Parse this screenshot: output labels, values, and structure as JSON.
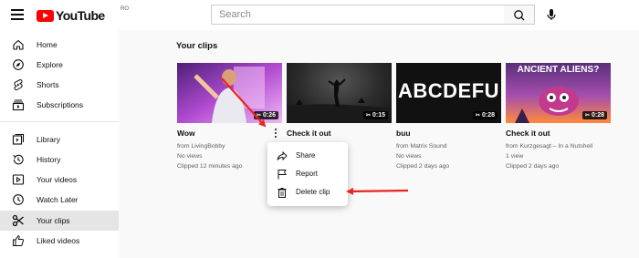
{
  "header": {
    "logo_text": "YouTube",
    "country_code": "RO",
    "search_placeholder": "Search"
  },
  "sidebar": {
    "items": [
      {
        "label": "Home",
        "icon": "home-icon"
      },
      {
        "label": "Explore",
        "icon": "compass-icon"
      },
      {
        "label": "Shorts",
        "icon": "shorts-icon"
      },
      {
        "label": "Subscriptions",
        "icon": "subscriptions-icon"
      },
      {
        "label": "Library",
        "icon": "library-icon"
      },
      {
        "label": "History",
        "icon": "history-icon"
      },
      {
        "label": "Your videos",
        "icon": "play-square-icon"
      },
      {
        "label": "Watch Later",
        "icon": "clock-icon"
      },
      {
        "label": "Your clips",
        "icon": "scissors-icon"
      },
      {
        "label": "Liked videos",
        "icon": "thumbs-up-icon"
      }
    ]
  },
  "main": {
    "title": "Your clips",
    "clips": [
      {
        "title": "Wow",
        "duration": "0:26",
        "channel": "from LivingBobby",
        "views": "No views",
        "clipped": "Clipped 12 minutes ago"
      },
      {
        "title": "Check it out",
        "duration": "0:15",
        "channel": "",
        "views": "",
        "clipped": ""
      },
      {
        "title": "buu",
        "duration": "0:28",
        "channel": "from Matrix Sound",
        "views": "No views",
        "clipped": "Clipped 2 days ago",
        "thumb_text": "ABCDEFU"
      },
      {
        "title": "Check it out",
        "duration": "0:28",
        "channel": "from Kurzgesagt – In a Nutshell",
        "views": "1 view",
        "clipped": "Clipped 2 days ago",
        "thumb_text": "ANCIENT ALIENS?"
      }
    ]
  },
  "menu": {
    "items": [
      {
        "label": "Share",
        "icon": "share-icon"
      },
      {
        "label": "Report",
        "icon": "flag-icon"
      },
      {
        "label": "Delete clip",
        "icon": "trash-icon"
      }
    ]
  },
  "colors": {
    "brand_red": "#ff0000",
    "annotation_red": "#e8251f",
    "active_bg": "#e5e5e5"
  }
}
